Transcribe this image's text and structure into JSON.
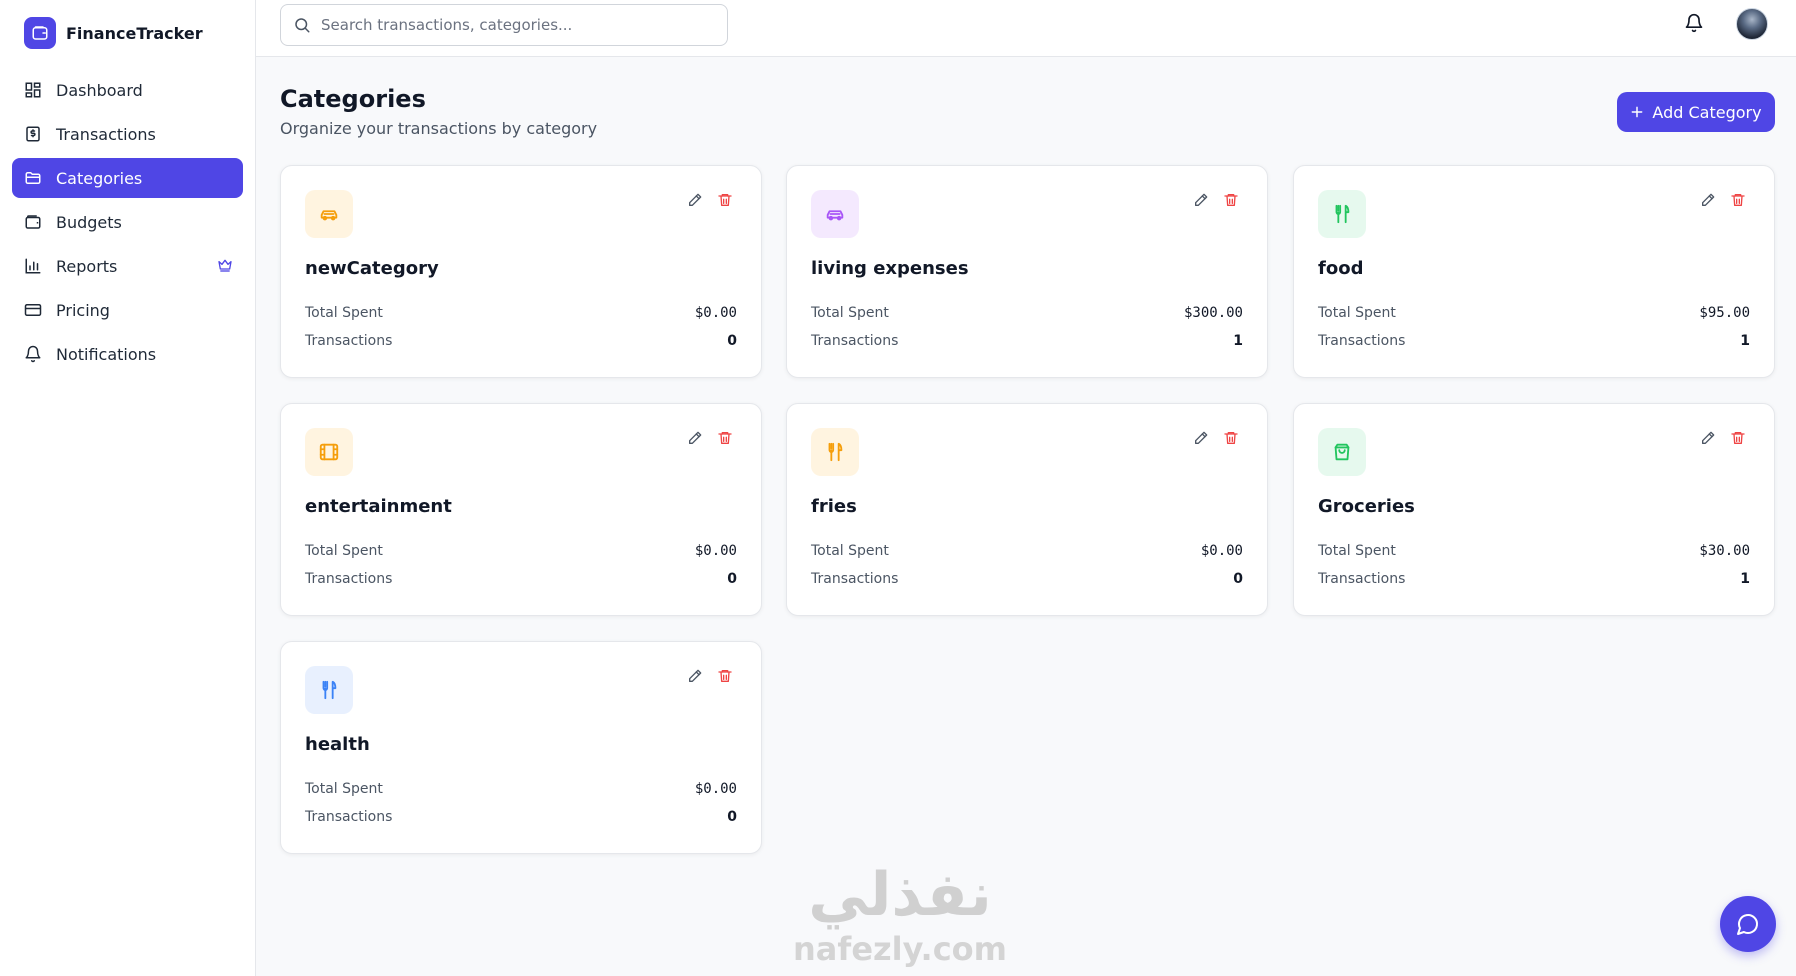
{
  "app": {
    "name": "FinanceTracker"
  },
  "sidebar": {
    "items": [
      {
        "label": "Dashboard",
        "icon": "dashboard-icon",
        "active": false
      },
      {
        "label": "Transactions",
        "icon": "receipt-icon",
        "active": false
      },
      {
        "label": "Categories",
        "icon": "folder-icon",
        "active": true
      },
      {
        "label": "Budgets",
        "icon": "wallet-icon",
        "active": false
      },
      {
        "label": "Reports",
        "icon": "bar-chart-icon",
        "active": false,
        "badge": "crown-icon"
      },
      {
        "label": "Pricing",
        "icon": "credit-card-icon",
        "active": false
      },
      {
        "label": "Notifications",
        "icon": "bell-icon",
        "active": false
      }
    ]
  },
  "search": {
    "placeholder": "Search transactions, categories..."
  },
  "header": {
    "title": "Categories",
    "subtitle": "Organize your transactions by category",
    "add_label": "Add Category"
  },
  "labels": {
    "total_spent": "Total Spent",
    "transactions": "Transactions"
  },
  "categories": [
    {
      "name": "newCategory",
      "total_spent": "$0.00",
      "transactions": "0",
      "icon": "car-icon",
      "color": "#f59e0b",
      "bg": "#fff4e0"
    },
    {
      "name": "living expenses",
      "total_spent": "$300.00",
      "transactions": "1",
      "icon": "car-icon",
      "color": "#a855f7",
      "bg": "#f4e9fe"
    },
    {
      "name": "food",
      "total_spent": "$95.00",
      "transactions": "1",
      "icon": "utensils-icon",
      "color": "#22c55e",
      "bg": "#e6f9ee"
    },
    {
      "name": "entertainment",
      "total_spent": "$0.00",
      "transactions": "0",
      "icon": "film-icon",
      "color": "#f59e0b",
      "bg": "#fff4e0"
    },
    {
      "name": "fries",
      "total_spent": "$0.00",
      "transactions": "0",
      "icon": "utensils-icon",
      "color": "#f59e0b",
      "bg": "#fff4e0"
    },
    {
      "name": "Groceries",
      "total_spent": "$30.00",
      "transactions": "1",
      "icon": "shopping-bag-icon",
      "color": "#22c55e",
      "bg": "#e6f9ee"
    },
    {
      "name": "health",
      "total_spent": "$0.00",
      "transactions": "0",
      "icon": "utensils-icon",
      "color": "#3b82f6",
      "bg": "#e8f0fe"
    }
  ],
  "watermark": {
    "glyph": "نفذلي",
    "text": "nafezly.com"
  },
  "colors": {
    "accent": "#4f46e5",
    "danger": "#ef4444"
  }
}
